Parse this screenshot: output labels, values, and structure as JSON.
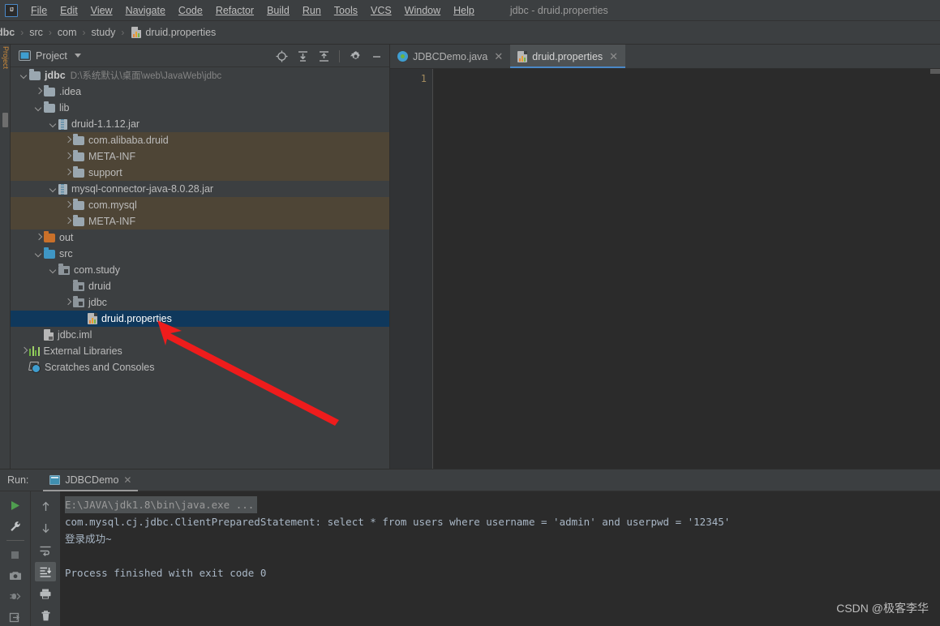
{
  "window": {
    "title": "jdbc - druid.properties",
    "logo_text": "IJ"
  },
  "menubar": {
    "items": [
      {
        "label": "File",
        "icon": "menu-file"
      },
      {
        "label": "Edit",
        "icon": "menu-edit"
      },
      {
        "label": "View",
        "icon": "menu-view"
      },
      {
        "label": "Navigate",
        "icon": "menu-navigate"
      },
      {
        "label": "Code",
        "icon": "menu-code"
      },
      {
        "label": "Refactor",
        "icon": "menu-refactor"
      },
      {
        "label": "Build",
        "icon": "menu-build"
      },
      {
        "label": "Run",
        "icon": "menu-run"
      },
      {
        "label": "Tools",
        "icon": "menu-tools"
      },
      {
        "label": "VCS",
        "icon": "menu-vcs"
      },
      {
        "label": "Window",
        "icon": "menu-window"
      },
      {
        "label": "Help",
        "icon": "menu-help"
      }
    ]
  },
  "breadcrumb": {
    "items": [
      "dbc",
      "src",
      "com",
      "study",
      "druid.properties"
    ],
    "separator": "›",
    "file_icon": "properties-file-icon"
  },
  "sidebar_strip": {
    "vertical_tab_label": "Project"
  },
  "project_panel": {
    "title": "Project",
    "caret_icon": "chevron-down-icon",
    "panel_icon": "project-view-icon",
    "toolbar": [
      {
        "name": "select-opened-file-icon",
        "label": "Select Opened File"
      },
      {
        "name": "expand-all-icon",
        "label": "Expand All"
      },
      {
        "name": "collapse-all-icon",
        "label": "Collapse All"
      },
      {
        "name": "settings-gear-icon",
        "label": "Settings"
      },
      {
        "name": "hide-panel-icon",
        "label": "Hide"
      }
    ],
    "tree": [
      {
        "label": "jdbc",
        "sub": "D:\\系统默认\\桌面\\web\\JavaWeb\\jdbc",
        "indent": 0,
        "arrow": "down",
        "icon": "module-folder-icon",
        "bold": true,
        "state": "normal"
      },
      {
        "label": ".idea",
        "sub": "",
        "indent": 1,
        "arrow": "right",
        "icon": "folder-icon",
        "bold": false,
        "state": "normal"
      },
      {
        "label": "lib",
        "sub": "",
        "indent": 1,
        "arrow": "down",
        "icon": "folder-icon",
        "bold": false,
        "state": "normal"
      },
      {
        "label": "druid-1.1.12.jar",
        "sub": "",
        "indent": 2,
        "arrow": "down",
        "icon": "jar-icon",
        "bold": false,
        "state": "normal"
      },
      {
        "label": "com.alibaba.druid",
        "sub": "",
        "indent": 3,
        "arrow": "right",
        "icon": "folder-icon",
        "bold": false,
        "state": "jarchild"
      },
      {
        "label": "META-INF",
        "sub": "",
        "indent": 3,
        "arrow": "right",
        "icon": "folder-icon",
        "bold": false,
        "state": "jarchild"
      },
      {
        "label": "support",
        "sub": "",
        "indent": 3,
        "arrow": "right",
        "icon": "folder-icon",
        "bold": false,
        "state": "jarchild"
      },
      {
        "label": "mysql-connector-java-8.0.28.jar",
        "sub": "",
        "indent": 2,
        "arrow": "down",
        "icon": "jar-icon",
        "bold": false,
        "state": "normal"
      },
      {
        "label": "com.mysql",
        "sub": "",
        "indent": 3,
        "arrow": "right",
        "icon": "folder-icon",
        "bold": false,
        "state": "jarchild"
      },
      {
        "label": "META-INF",
        "sub": "",
        "indent": 3,
        "arrow": "right",
        "icon": "folder-icon",
        "bold": false,
        "state": "jarchild"
      },
      {
        "label": "out",
        "sub": "",
        "indent": 1,
        "arrow": "right",
        "icon": "output-folder-icon",
        "bold": false,
        "state": "normal"
      },
      {
        "label": "src",
        "sub": "",
        "indent": 1,
        "arrow": "down",
        "icon": "source-folder-icon",
        "bold": false,
        "state": "normal"
      },
      {
        "label": "com.study",
        "sub": "",
        "indent": 2,
        "arrow": "down",
        "icon": "package-icon",
        "bold": false,
        "state": "normal"
      },
      {
        "label": "druid",
        "sub": "",
        "indent": 3,
        "arrow": "none",
        "icon": "package-icon",
        "bold": false,
        "state": "normal"
      },
      {
        "label": "jdbc",
        "sub": "",
        "indent": 3,
        "arrow": "right",
        "icon": "package-icon",
        "bold": false,
        "state": "normal"
      },
      {
        "label": "druid.properties",
        "sub": "",
        "indent": 4,
        "arrow": "none",
        "icon": "properties-file-icon",
        "bold": false,
        "state": "selected"
      },
      {
        "label": "jdbc.iml",
        "sub": "",
        "indent": 1,
        "arrow": "none",
        "icon": "iml-file-icon",
        "bold": false,
        "state": "normal"
      },
      {
        "label": "External Libraries",
        "sub": "",
        "indent": 0,
        "arrow": "right",
        "icon": "external-libraries-icon",
        "bold": false,
        "state": "normal"
      },
      {
        "label": "Scratches and Consoles",
        "sub": "",
        "indent": 0,
        "arrow": "none",
        "icon": "scratches-icon",
        "bold": false,
        "state": "normal"
      }
    ]
  },
  "editor": {
    "tabs": [
      {
        "label": "JDBCDemo.java",
        "icon": "java-class-icon",
        "active": false,
        "close_glyph": "✕"
      },
      {
        "label": "druid.properties",
        "icon": "properties-file-icon",
        "active": true,
        "close_glyph": "✕"
      }
    ],
    "line_numbers": [
      "1"
    ],
    "content_lines": [
      ""
    ]
  },
  "run_panel": {
    "label": "Run:",
    "tab": {
      "label": "JDBCDemo",
      "icon": "run-config-icon",
      "close_glyph": "✕"
    },
    "toolbar_left": [
      {
        "name": "rerun-icon",
        "label": "Rerun"
      },
      {
        "name": "wrench-icon",
        "label": "Edit Configuration"
      },
      {
        "name": "stop-icon",
        "label": "Stop"
      },
      {
        "name": "camera-icon",
        "label": "Dump Threads"
      },
      {
        "name": "debug-restart-icon",
        "label": "Restart Debug"
      },
      {
        "name": "export-icon",
        "label": "Export"
      }
    ],
    "toolbar_right": [
      {
        "name": "arrow-up-icon",
        "label": "Up the Stack Trace"
      },
      {
        "name": "arrow-down-icon",
        "label": "Down the Stack Trace"
      },
      {
        "name": "soft-wrap-icon",
        "label": "Soft-Wrap"
      },
      {
        "name": "scroll-to-end-icon",
        "label": "Scroll to End",
        "selected": true
      },
      {
        "name": "print-icon",
        "label": "Print"
      },
      {
        "name": "trash-icon",
        "label": "Clear All"
      }
    ],
    "console_lines": [
      {
        "text": "E:\\JAVA\\jdk1.8\\bin\\java.exe ...",
        "style": "command"
      },
      {
        "text": "com.mysql.cj.jdbc.ClientPreparedStatement: select * from users where username = 'admin' and userpwd = '12345'",
        "style": "output"
      },
      {
        "text": "登录成功~",
        "style": "output"
      },
      {
        "text": "",
        "style": "output"
      },
      {
        "text": "Process finished with exit code 0",
        "style": "output"
      }
    ]
  },
  "annotation": {
    "arrow_color": "#ee1c1c",
    "arrow_label": "red-pointer-arrow"
  },
  "watermark": {
    "text": "CSDN @极客李华"
  },
  "colors": {
    "panel_bg": "#3c3f41",
    "editor_bg": "#2b2b2b",
    "selection_blue": "#0f385c",
    "jar_child_bg": "#4e4536",
    "accent_blue": "#4a88c7",
    "text": "#bbbbbb"
  }
}
